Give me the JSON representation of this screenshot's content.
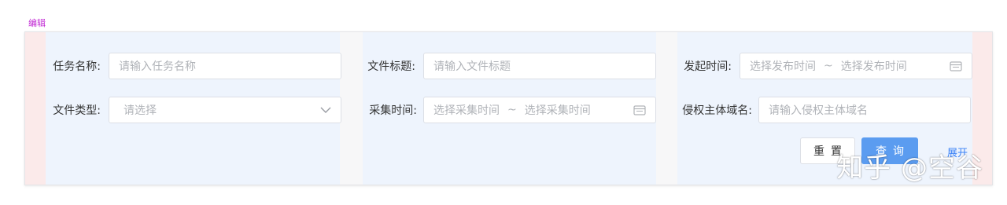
{
  "edit_tag": "编辑",
  "form": {
    "task_name": {
      "label": "任务名称:",
      "placeholder": "请输入任务名称"
    },
    "file_title": {
      "label": "文件标题:",
      "placeholder": "请输入文件标题"
    },
    "publish_time": {
      "label": "发起时间:",
      "start_placeholder": "选择发布时间",
      "separator": "~",
      "end_placeholder": "选择发布时间"
    },
    "file_type": {
      "label": "文件类型:",
      "placeholder": "请选择"
    },
    "collect_time": {
      "label": "采集时间:",
      "start_placeholder": "选择采集时间",
      "separator": "~",
      "end_placeholder": "选择采集时间"
    },
    "infringer_domain": {
      "label": "侵权主体域名:",
      "placeholder": "请输入侵权主体域名"
    }
  },
  "actions": {
    "reset_label": "重置",
    "query_label": "查询",
    "expand_label": "展开"
  },
  "watermark": "知乎 @空谷",
  "colors": {
    "primary": "#5b9cf0",
    "column_bg": "#eef4fd",
    "padding_bg": "#fbeaea",
    "edit_tag": "#c026d3"
  }
}
